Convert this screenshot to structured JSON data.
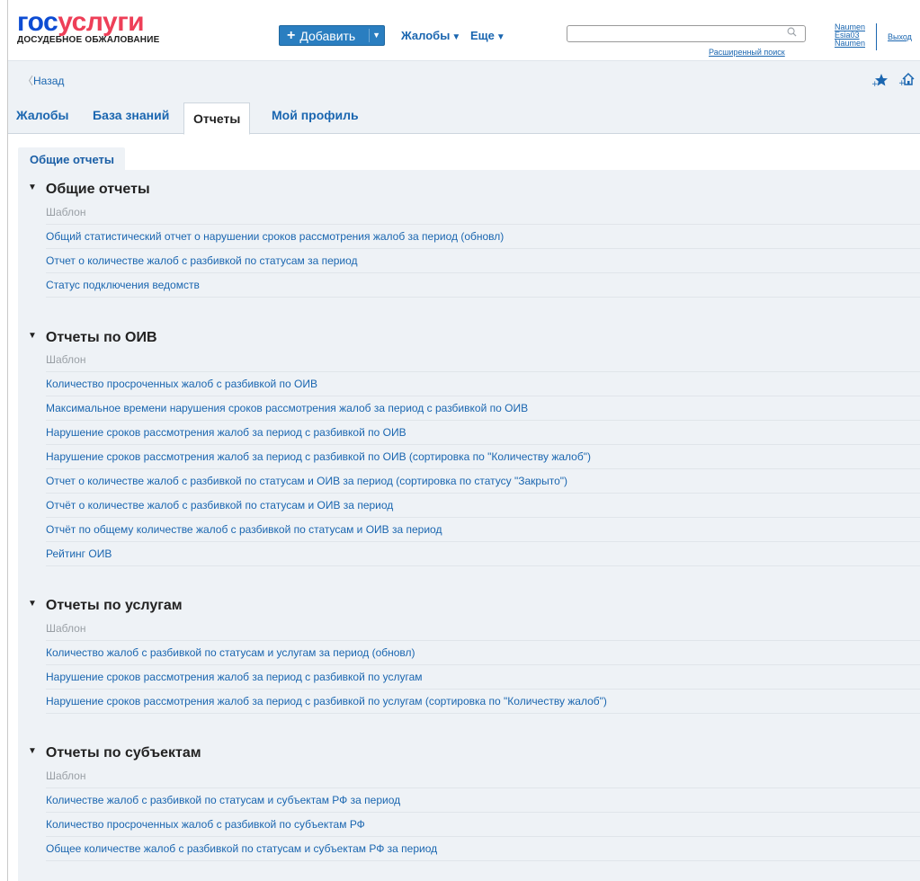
{
  "header": {
    "logo_main_gos": "гос",
    "logo_main_uslugi": "услуги",
    "logo_sub": "ДОСУДЕБНОЕ ОБЖАЛОВАНИЕ",
    "add_button": "Добавить",
    "nav_complaints": "Жалобы",
    "nav_more": "Еще",
    "search_value": "",
    "advanced_search": "Расширенный поиск",
    "user_line1": "Naumen",
    "user_line2": "Esia03",
    "user_line3": "Naumen",
    "logout": "Выход"
  },
  "back": "Назад",
  "tabs": [
    {
      "label": "Жалобы"
    },
    {
      "label": "База знаний"
    },
    {
      "label": "Отчеты"
    },
    {
      "label": "Мой профиль"
    }
  ],
  "subtab": "Общие отчеты",
  "sections": [
    {
      "title": "Общие отчеты",
      "header": "Шаблон",
      "items": [
        "Общий статистический отчет о нарушении сроков рассмотрения жалоб за период (обновл)",
        "Отчет о количестве жалоб с разбивкой по статусам за период",
        "Статус подключения ведомств"
      ]
    },
    {
      "title": "Отчеты по ОИВ",
      "header": "Шаблон",
      "items": [
        "Количество просроченных жалоб с разбивкой по ОИВ",
        "Максимальное времени нарушения сроков рассмотрения жалоб за период с разбивкой по ОИВ",
        "Нарушение сроков рассмотрения жалоб за период с разбивкой по ОИВ",
        "Нарушение сроков рассмотрения жалоб за период с разбивкой по ОИВ (сортировка по \"Количеству жалоб\")",
        "Отчет о количестве жалоб с разбивкой по статусам и ОИВ за период (сортировка по статусу \"Закрыто\")",
        "Отчёт о количестве жалоб с разбивкой по статусам и ОИВ за период",
        "Отчёт по общему количестве жалоб с разбивкой по статусам и ОИВ за период",
        "Рейтинг ОИВ"
      ]
    },
    {
      "title": "Отчеты по услугам",
      "header": "Шаблон",
      "items": [
        "Количество жалоб с разбивкой по статусам и услугам за период (обновл)",
        "Нарушение сроков рассмотрения жалоб за период с разбивкой по услугам",
        "Нарушение сроков рассмотрения жалоб за период с разбивкой по услугам (сортировка по \"Количеству жалоб\")"
      ]
    },
    {
      "title": "Отчеты по субъектам",
      "header": "Шаблон",
      "items": [
        "Количестве жалоб с разбивкой по статусам и субъектам РФ за период",
        "Количество просроченных жалоб с разбивкой по субъектам РФ",
        "Общее количестве жалоб с разбивкой по статусам и субъектам РФ за период"
      ]
    }
  ],
  "colors": {
    "brand_blue": "#0d4cd3",
    "brand_red": "#ee3f58",
    "link": "#1a66b0",
    "panel_bg": "#eef2f6",
    "button_bg": "#2a7ec0"
  }
}
